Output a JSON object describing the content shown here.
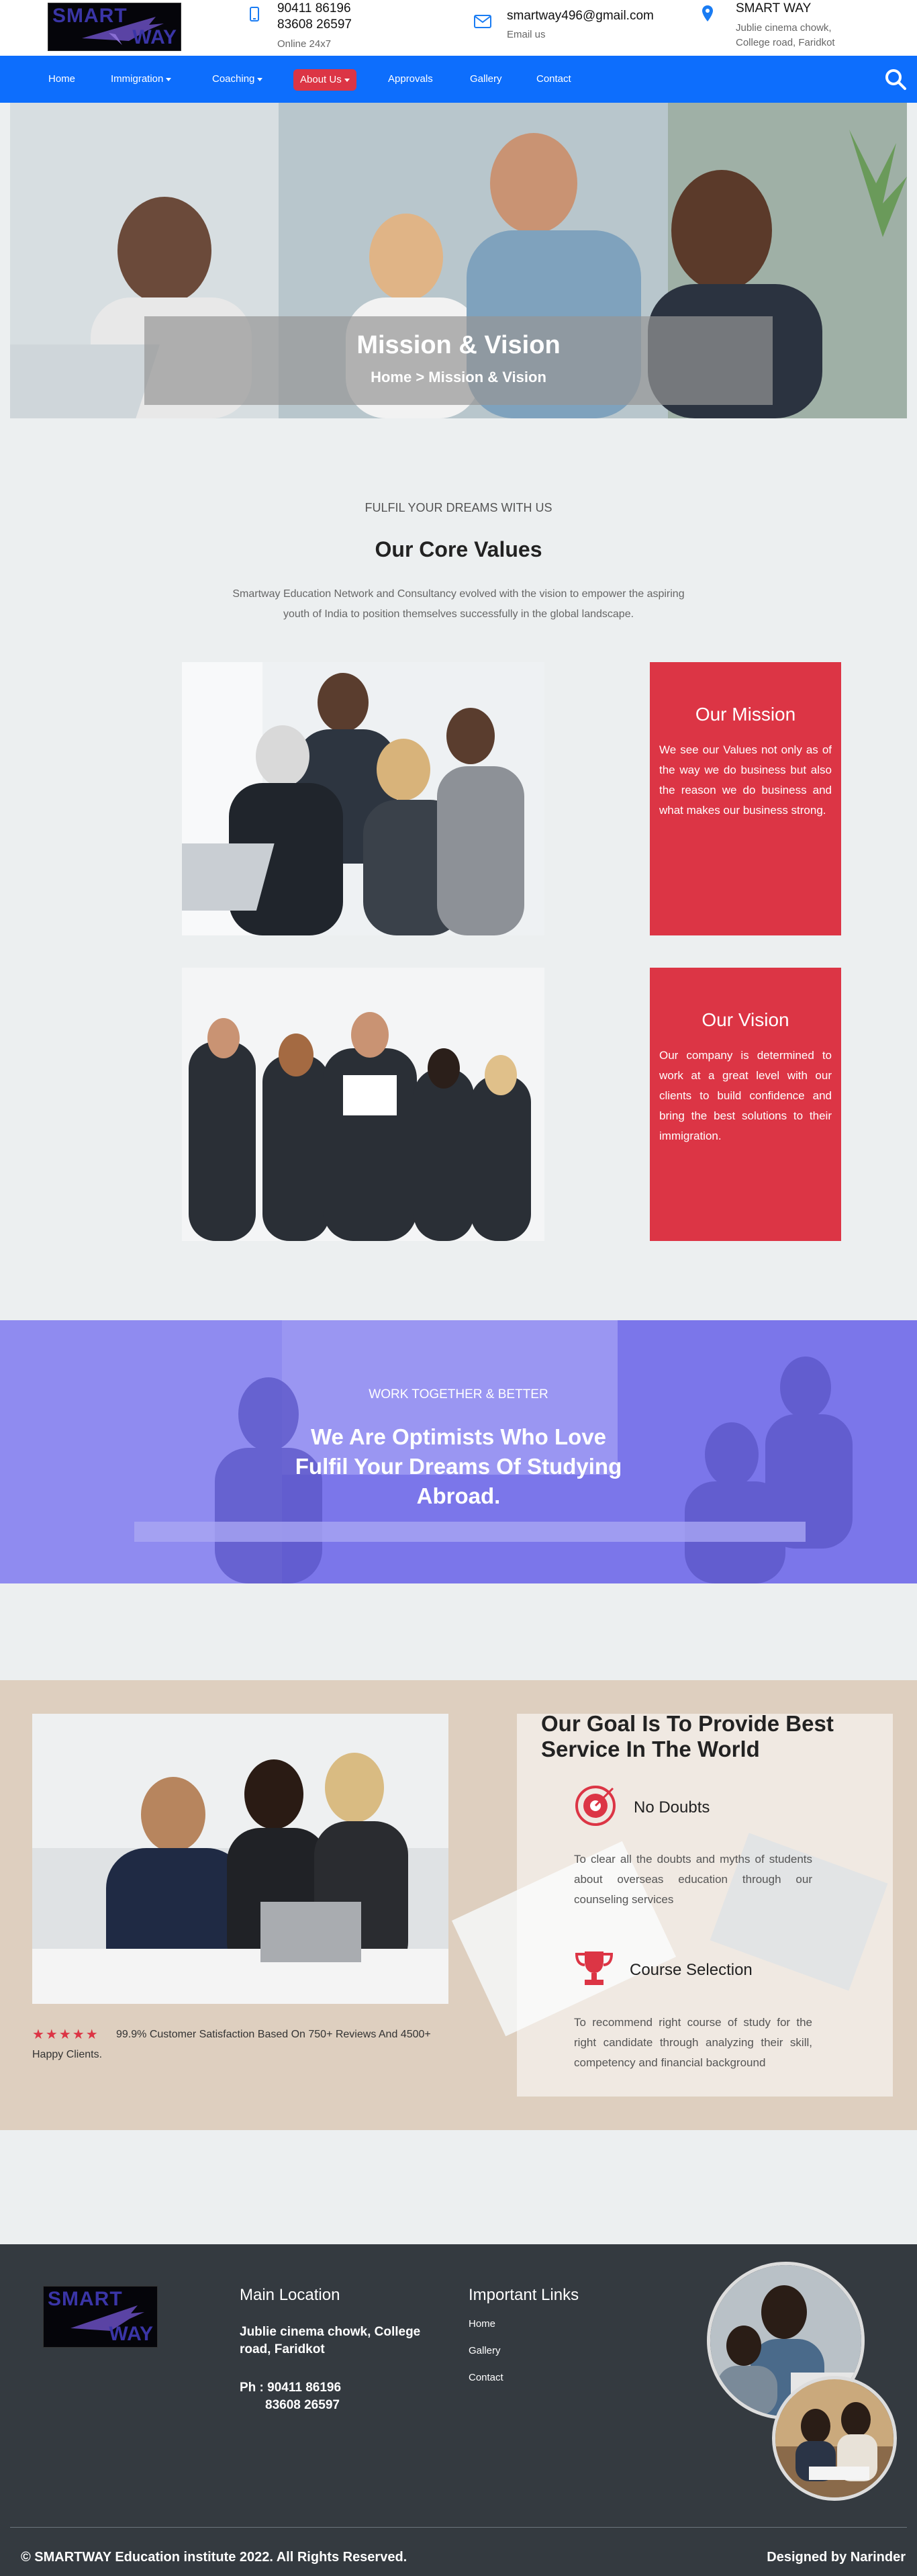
{
  "topbar": {
    "logo": {
      "line1": "SMART",
      "line2": "WAY"
    },
    "phone": {
      "line1": "90411 86196",
      "line2": "83608 26597",
      "sub": "Online 24x7",
      "icon": "phone-icon"
    },
    "email": {
      "address": "smartway496@gmail.com",
      "sub": "Email us",
      "icon": "envelope-icon"
    },
    "location": {
      "name": "SMART WAY",
      "line1": "Jublie cinema chowk,",
      "line2": "College road, Faridkot",
      "icon": "map-pin-icon"
    }
  },
  "nav": {
    "items": [
      "Home",
      "Immigration",
      "Coaching",
      "About Us",
      "Approvals",
      "Gallery",
      "Contact"
    ],
    "search_icon": "search-icon",
    "active_color": "#dc3545",
    "bar_color": "#0d6efd"
  },
  "hero": {
    "title": "Mission & Vision",
    "breadcrumb": "Home > Mission & Vision"
  },
  "core": {
    "kicker": "FULFIL YOUR DREAMS WITH US",
    "title": "Our Core Values",
    "description": "Smartway Education Network and Consultancy evolved with the vision to empower the aspiring youth of India to position themselves successfully in the global landscape.",
    "mission": {
      "title": "Our Mission",
      "text": "We see our Values not only as of the way we do business but also the reason we do business and what makes our business strong."
    },
    "vision": {
      "title": "Our Vision",
      "text": "Our company is determined to work at a great level with our clients to build confidence and bring the best solutions to their immigration."
    }
  },
  "banner": {
    "kicker": "WORK TOGETHER & BETTER",
    "title": "We Are Optimists Who Love Fulfil Your Dreams Of Studying Abroad."
  },
  "goal": {
    "rating_stars": "★★★★★",
    "rating_value": 5,
    "satisfaction": "99.9% Customer Satisfaction Based On 750+ Reviews And 4500+ Happy Clients.",
    "title": "Our Goal Is To Provide Best Service In The World",
    "features": [
      {
        "icon": "target-icon",
        "title": "No Doubts",
        "text": "To clear all the doubts and myths of students about overseas education through our counseling services"
      },
      {
        "icon": "trophy-icon",
        "title": "Course Selection",
        "text": "To recommend right course of study for the right candidate through analyzing their skill, competency and financial background"
      }
    ]
  },
  "footer": {
    "logo": {
      "line1": "SMART",
      "line2": "WAY"
    },
    "location_heading": "Main Location",
    "address": "Jublie cinema chowk, College road, Faridkot",
    "phone_line1": "Ph : 90411 86196",
    "phone_line2": "83608 26597",
    "links_heading": "Important Links",
    "links": [
      "Home",
      "Gallery",
      "Contact"
    ],
    "copyright": "© SMARTWAY Education institute 2022. All Rights Reserved.",
    "credit": "Designed by Narinder"
  }
}
